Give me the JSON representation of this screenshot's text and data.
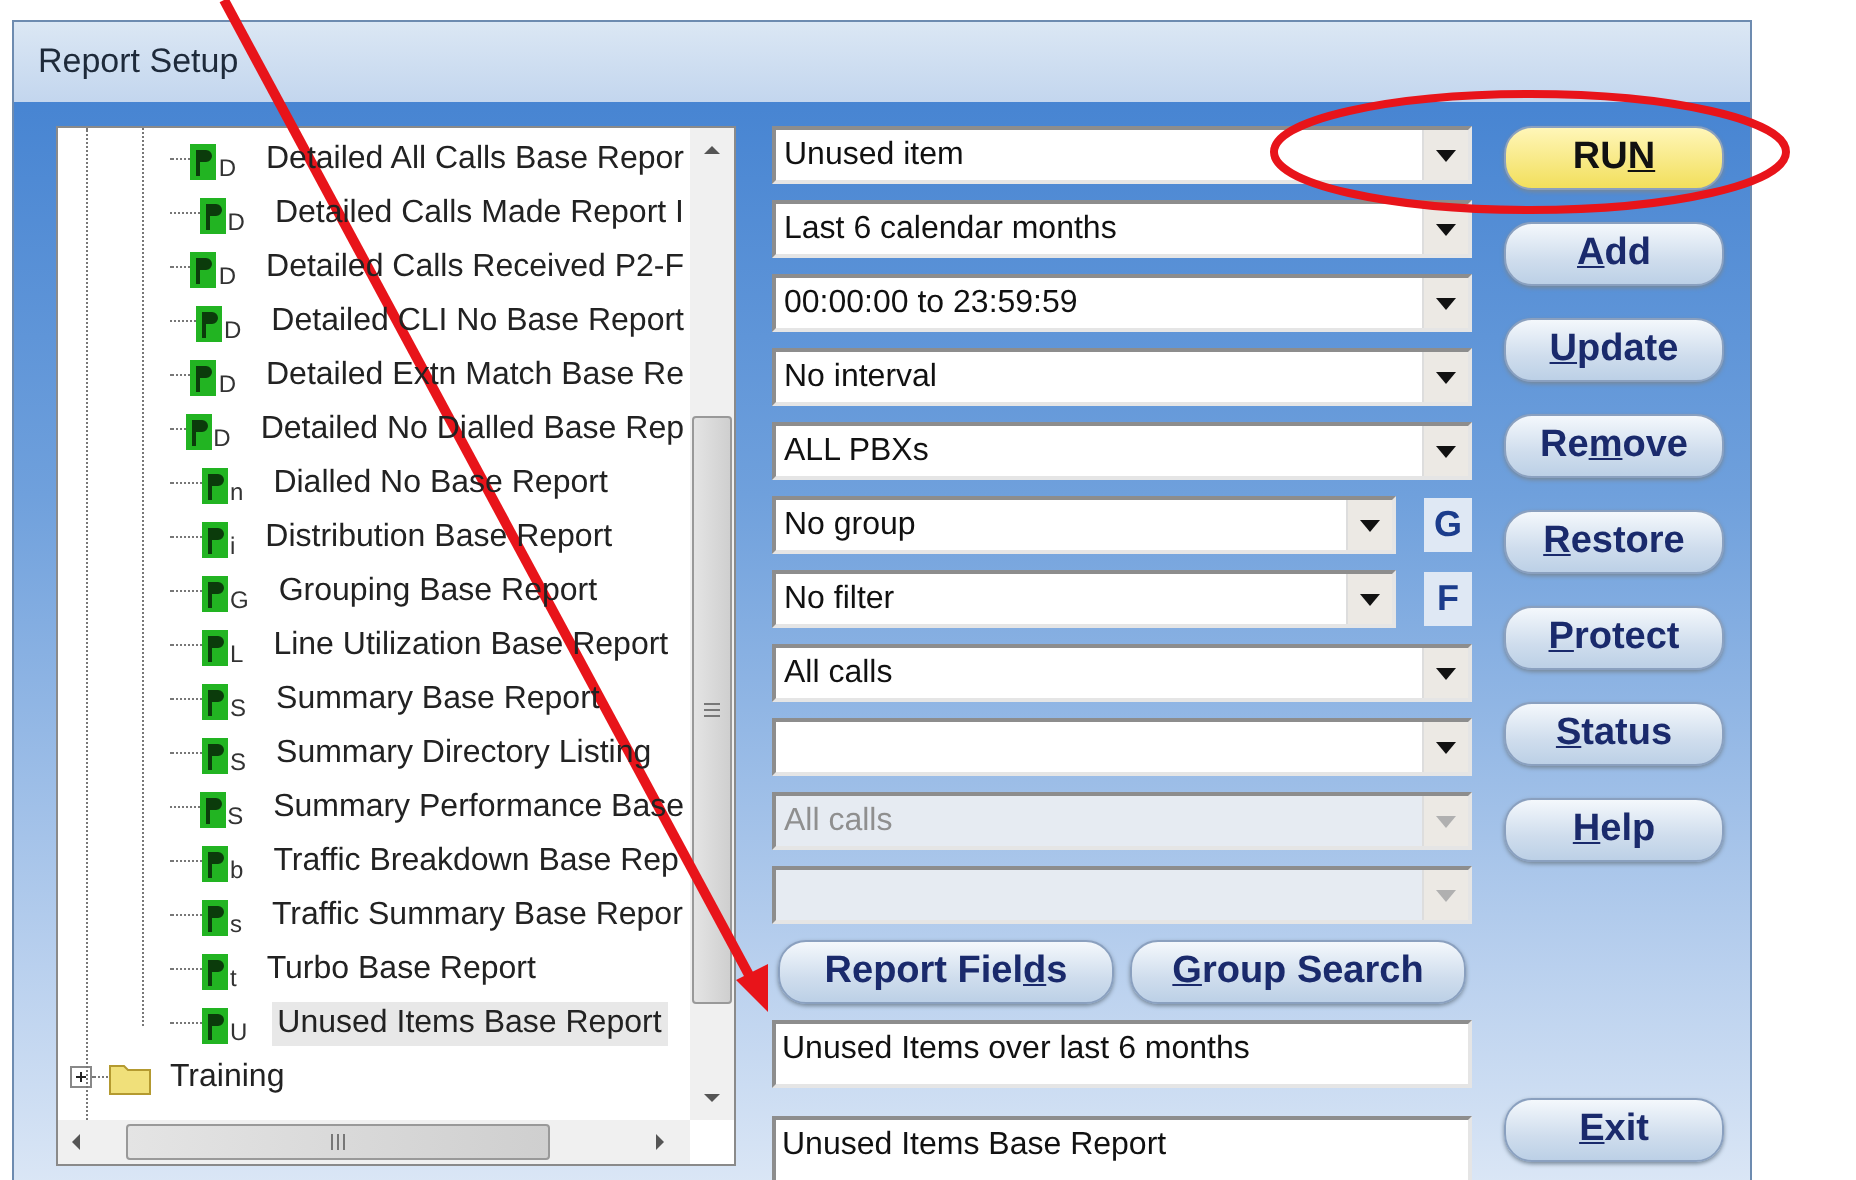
{
  "window": {
    "title": "Report Setup"
  },
  "tree": {
    "items": [
      {
        "label": "Detailed All Calls Base Repor",
        "badge": "D",
        "selected": false
      },
      {
        "label": "Detailed Calls Made Report I",
        "badge": "D",
        "selected": false
      },
      {
        "label": "Detailed Calls Received P2-F",
        "badge": "D",
        "selected": false
      },
      {
        "label": "Detailed CLI No Base Report",
        "badge": "D",
        "selected": false
      },
      {
        "label": "Detailed Extn Match Base Re",
        "badge": "D",
        "selected": false
      },
      {
        "label": "Detailed No Dialled Base Rep",
        "badge": "D",
        "selected": false
      },
      {
        "label": "Dialled No Base Report",
        "badge": "n",
        "selected": false
      },
      {
        "label": "Distribution Base Report",
        "badge": "i",
        "selected": false
      },
      {
        "label": "Grouping Base Report",
        "badge": "G",
        "selected": false
      },
      {
        "label": "Line Utilization Base Report",
        "badge": "L",
        "selected": false
      },
      {
        "label": "Summary Base Report",
        "badge": "S",
        "selected": false
      },
      {
        "label": "Summary Directory Listing",
        "badge": "S",
        "selected": false
      },
      {
        "label": "Summary Performance Base",
        "badge": "S",
        "selected": false
      },
      {
        "label": "Traffic Breakdown Base Rep",
        "badge": "b",
        "selected": false
      },
      {
        "label": "Traffic Summary Base Repor",
        "badge": "s",
        "selected": false
      },
      {
        "label": "Turbo Base Report",
        "badge": "t",
        "selected": false
      },
      {
        "label": "Unused Items Base Report",
        "badge": "U",
        "selected": true
      }
    ],
    "folder": {
      "label": "Training",
      "expanded": false
    }
  },
  "dropdowns": [
    {
      "value": "Unused item",
      "disabled": false
    },
    {
      "value": "Last 6 calendar months",
      "disabled": false
    },
    {
      "value": "00:00:00 to 23:59:59",
      "disabled": false
    },
    {
      "value": "No interval",
      "disabled": false
    },
    {
      "value": "ALL PBXs",
      "disabled": false
    },
    {
      "value": "No group",
      "disabled": false,
      "side_button": "G"
    },
    {
      "value": "No filter",
      "disabled": false,
      "side_button": "F"
    },
    {
      "value": "All calls",
      "disabled": false
    },
    {
      "disabled": false
    },
    {
      "value": "All calls",
      "disabled": true
    },
    {
      "disabled": true
    }
  ],
  "middle_buttons": [
    {
      "before": "Report Fiel",
      "key": "d",
      "after": "s"
    },
    {
      "key": "G",
      "after": "roup Search"
    }
  ],
  "description": "Unused Items over last 6 months",
  "report_name": "Unused Items Base Report",
  "buttons": [
    {
      "before": "RU",
      "key": "N",
      "kind": "primary"
    },
    {
      "key": "A",
      "after": "dd",
      "kind": "normal"
    },
    {
      "key": "U",
      "after": "pdate",
      "kind": "normal"
    },
    {
      "before": "Re",
      "key": "m",
      "after": "ove",
      "kind": "normal"
    },
    {
      "key": "R",
      "after": "estore",
      "kind": "normal"
    },
    {
      "key": "P",
      "after": "rotect",
      "kind": "normal"
    },
    {
      "key": "S",
      "after": "tatus",
      "kind": "normal"
    },
    {
      "key": "H",
      "after": "elp",
      "kind": "normal"
    }
  ],
  "exit_button": {
    "key": "E",
    "after": "xit"
  }
}
